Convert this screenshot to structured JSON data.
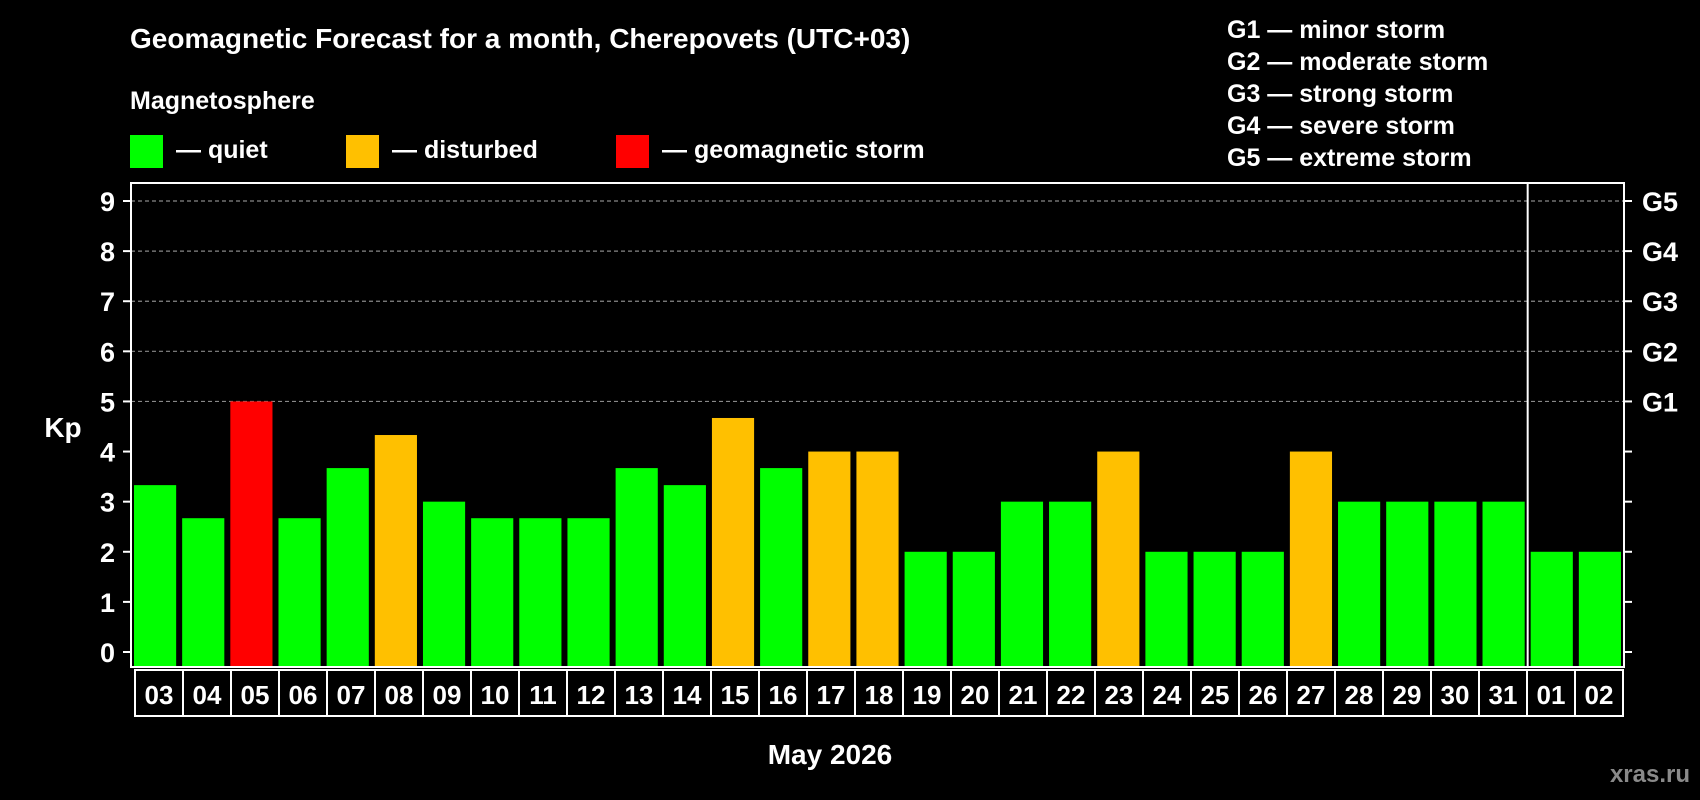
{
  "chart_data": {
    "type": "bar",
    "title": "Geomagnetic Forecast for a month, Cherepovets (UTC+03)",
    "ylabel": "Kp",
    "xlabel": "May 2026",
    "ylim": [
      0,
      9.3
    ],
    "yticks": [
      0,
      1,
      2,
      3,
      4,
      5,
      6,
      7,
      8,
      9
    ],
    "grid": "dashed horizontal at 5-9",
    "categories": [
      "03",
      "04",
      "05",
      "06",
      "07",
      "08",
      "09",
      "10",
      "11",
      "12",
      "13",
      "14",
      "15",
      "16",
      "17",
      "18",
      "19",
      "20",
      "21",
      "22",
      "23",
      "24",
      "25",
      "26",
      "27",
      "28",
      "29",
      "30",
      "31",
      "01",
      "02"
    ],
    "values": [
      3.33,
      2.67,
      5.0,
      2.67,
      3.67,
      4.33,
      3.0,
      2.67,
      2.67,
      2.67,
      3.67,
      3.33,
      4.67,
      3.67,
      4.0,
      4.0,
      2.0,
      2.0,
      3.0,
      3.0,
      4.0,
      2.0,
      2.0,
      2.0,
      4.0,
      3.0,
      3.0,
      3.0,
      3.0,
      2.0,
      2.0
    ],
    "month_divider_after": "31",
    "legend_title": "Magnetosphere",
    "legend": [
      {
        "label": "— quiet",
        "color": "#00ff00"
      },
      {
        "label": "— disturbed",
        "color": "#ffc000"
      },
      {
        "label": "— geomagnetic storm",
        "color": "#ff0000"
      }
    ],
    "storm_levels": [
      {
        "label": "G1 — minor storm",
        "kp": 5,
        "tick": "G1"
      },
      {
        "label": "G2 — moderate storm",
        "kp": 6,
        "tick": "G2"
      },
      {
        "label": "G3 — strong storm",
        "kp": 7,
        "tick": "G3"
      },
      {
        "label": "G4 — severe storm",
        "kp": 8,
        "tick": "G4"
      },
      {
        "label": "G5 — extreme storm",
        "kp": 9,
        "tick": "G5"
      }
    ],
    "watermark": "xras.ru"
  }
}
